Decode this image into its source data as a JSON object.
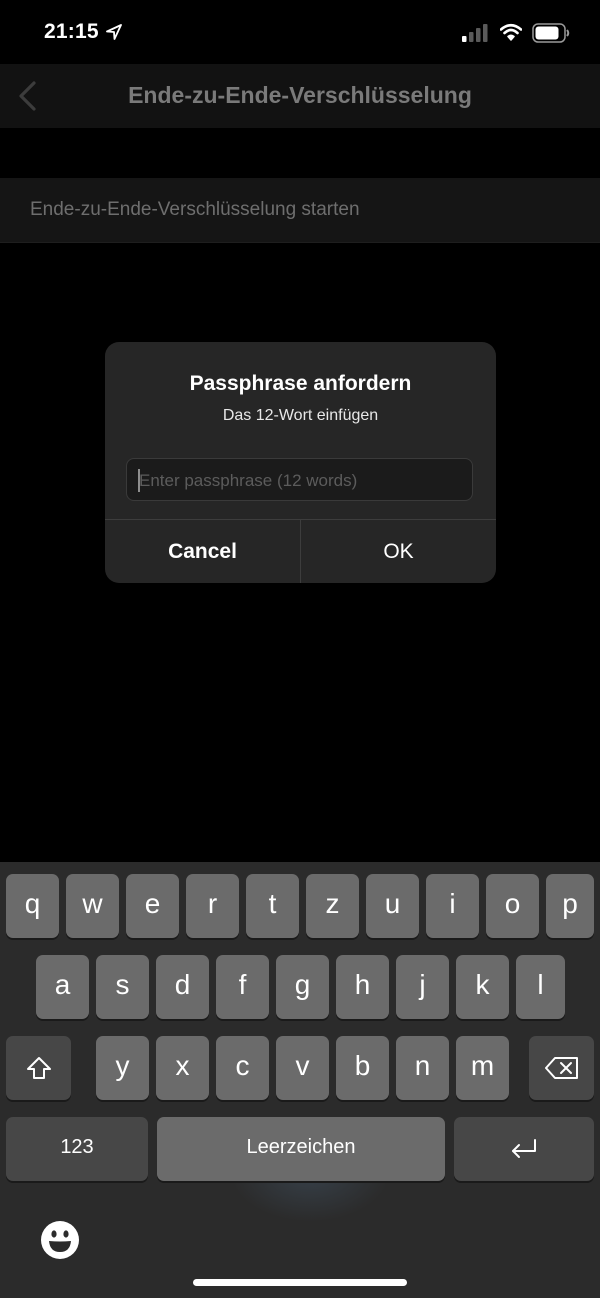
{
  "status": {
    "time": "21:15"
  },
  "nav": {
    "title": "Ende-zu-Ende-Verschlüsselung"
  },
  "list": {
    "start_label": "Ende-zu-Ende-Verschlüsselung starten"
  },
  "dialog": {
    "title": "Passphrase anfordern",
    "message": "Das 12-Wort einfügen",
    "input_placeholder": "Enter passphrase (12 words)",
    "input_value": "",
    "cancel_label": "Cancel",
    "ok_label": "OK"
  },
  "keyboard": {
    "row1": [
      "q",
      "w",
      "e",
      "r",
      "t",
      "z",
      "u",
      "i",
      "o",
      "p"
    ],
    "row2": [
      "a",
      "s",
      "d",
      "f",
      "g",
      "h",
      "j",
      "k",
      "l"
    ],
    "row3": [
      "y",
      "x",
      "c",
      "v",
      "b",
      "n",
      "m"
    ],
    "numbers_label": "123",
    "space_label": "Leerzeichen"
  }
}
